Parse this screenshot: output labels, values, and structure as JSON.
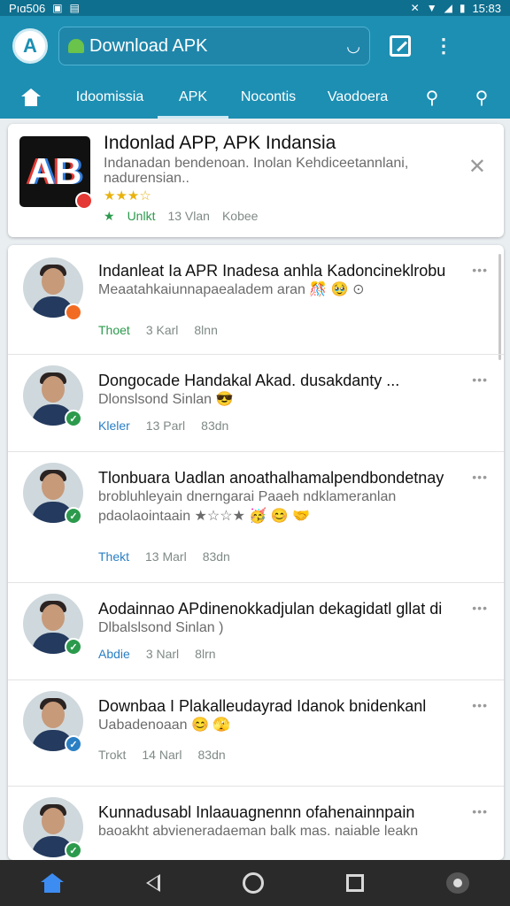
{
  "colors": {
    "primary": "#1d8fb3",
    "status": "#0f6f8f",
    "accent_green": "#2c9a4c",
    "star": "#e8b20e"
  },
  "status_bar": {
    "left_text": "Pıɑ506",
    "time": "15:83"
  },
  "app_bar": {
    "search_text": "Download APK"
  },
  "tabs": [
    {
      "label": "Idoomissia"
    },
    {
      "label": "APK"
    },
    {
      "label": "Nocontis"
    },
    {
      "label": "Vaodoera"
    }
  ],
  "featured": {
    "title": "Indonlad APP, APK Indansia",
    "description": "Indanadan bendenoan. Inolan Kehdiceetannlani, nadurensian..",
    "stars": "★★★☆",
    "meta": [
      "Unlkt",
      "13 Vlan",
      "Kobee"
    ]
  },
  "posts": [
    {
      "title": "Indanleat Ia APR Inadesa anhla Kadoncineklrobu",
      "description": "Meaatahkaiunnapaealadem aran 🎊 🥹 ⊙",
      "meta": [
        "Thoet",
        "3 Karl",
        "8lnn"
      ],
      "badge_color": "#f26b22",
      "badge": ""
    },
    {
      "title": "Dongocade Handakal Akad. dusakdanty ...",
      "description": "Dlonslsond Sinlan 😎",
      "meta": [
        "Kleler",
        "13 Parl",
        "83dn"
      ],
      "badge_color": "#2c9a4c",
      "badge": "✓"
    },
    {
      "title": "Tlonbuara Uadlan anoathalhamalpendbondetnay",
      "description": "brobluhleyain dnerngarai Paaeh ndklameranlan pdaolaointaain ★☆☆★ 🥳 😊 🤝",
      "meta": [
        "Thekt",
        "13 Marl",
        "83dn"
      ],
      "badge_color": "#2c9a4c",
      "badge": "✓"
    },
    {
      "title": "Aodainnao APdinenokkadjulan dekagidatl gllat di",
      "description": "Dlbalslsond Sinlan )",
      "meta": [
        "Abdie",
        "3 Narl",
        "8lrn"
      ],
      "badge_color": "#2c9a4c",
      "badge": "✓"
    },
    {
      "title": "Downbaa I Plakalleudayrad Idanok bnidenkanl",
      "description": "Uabadenoaan 😊 🫣",
      "meta": [
        "Trokt",
        "14 Narl",
        "83dn"
      ],
      "badge_color": "#2a7fc4",
      "badge": "✓"
    },
    {
      "title": "Kunnadusabl Inlaauagnennn ofahenainnpain",
      "description": "baoakht abvieneradaeman balk mas. naiable leakn",
      "meta": [
        "",
        "",
        ""
      ],
      "badge_color": "#2c9a4c",
      "badge": "✓"
    }
  ]
}
